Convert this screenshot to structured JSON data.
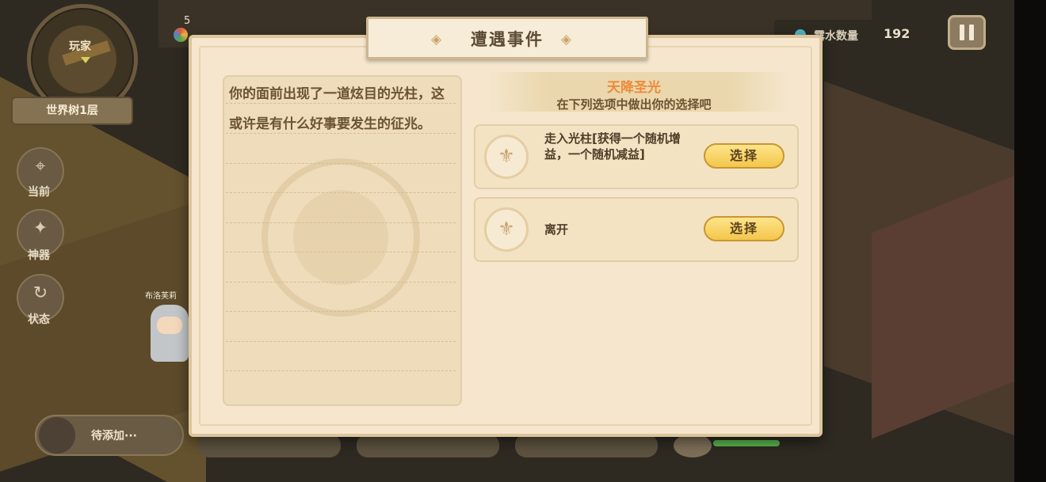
{
  "hud": {
    "minimap_label": "玩家",
    "floor_label": "世界树1层",
    "coin_count": "5",
    "water": {
      "label": "露水数量",
      "value": "192"
    },
    "side_buttons": [
      {
        "label": "当前",
        "icon": "location-pin-icon"
      },
      {
        "label": "神器",
        "icon": "star-compass-icon"
      },
      {
        "label": "状态",
        "icon": "status-swirl-icon"
      }
    ],
    "bottom": {
      "add_label": "待添加···"
    },
    "character_tag": "布洛芙莉",
    "hp_fraction": 0.7
  },
  "modal": {
    "title": "遭遇事件",
    "description": "你的面前出现了一道炫目的光柱，这或许是有什么好事要发生的征兆。",
    "event_name": "天降圣光",
    "prompt": "在下列选项中做出你的选择吧",
    "options": [
      {
        "text": "走入光柱[获得一个随机增益，一个随机减益]",
        "button": "选择"
      },
      {
        "text": "离开",
        "button": "选择"
      }
    ]
  },
  "colors": {
    "panel": "#f5e6cd",
    "event_name": "#ec8b3a",
    "button": "#f4c64b",
    "text": "#6b5333"
  }
}
